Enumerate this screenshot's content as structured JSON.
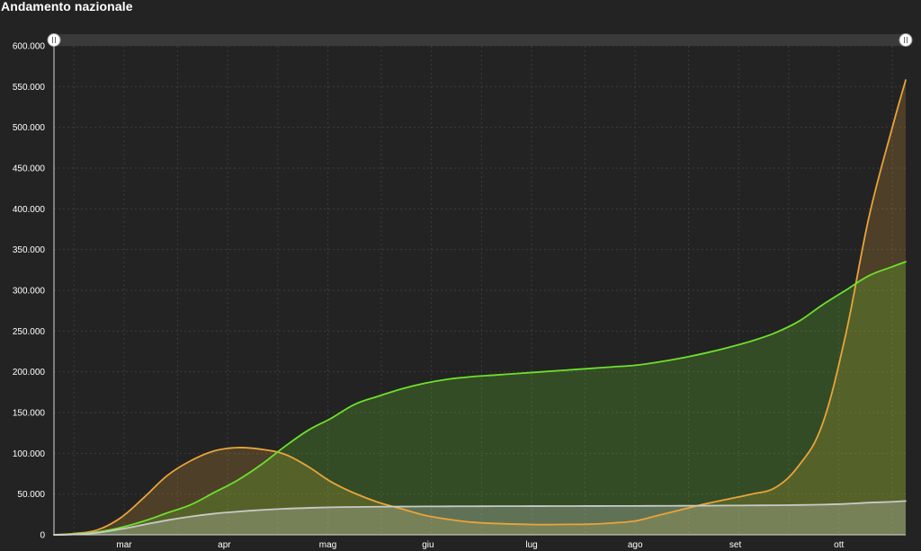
{
  "title": "Andamento nazionale",
  "colors": {
    "background": "#232323",
    "orange": "#e9a43a",
    "green": "#6ee02c",
    "gray": "#c9c9c6",
    "grid": "#3c3c3c",
    "range_bar": "#3a3a3a"
  },
  "chart_data": {
    "type": "area",
    "title": "Andamento nazionale",
    "ylim": [
      0,
      600000
    ],
    "y_ticks": [
      0,
      50000,
      100000,
      150000,
      200000,
      250000,
      300000,
      350000,
      400000,
      450000,
      500000,
      550000,
      600000
    ],
    "y_tick_labels": [
      "0",
      "50.000",
      "100.000",
      "150.000",
      "200.000",
      "250.000",
      "300.000",
      "350.000",
      "400.000",
      "450.000",
      "500.000",
      "550.000",
      "600.000"
    ],
    "x_tick_labels": [
      "mar",
      "apr",
      "mag",
      "giu",
      "lug",
      "ago",
      "set",
      "ott"
    ],
    "x": [
      "2020-02-24",
      "2020-03-01",
      "2020-03-08",
      "2020-03-15",
      "2020-03-22",
      "2020-03-29",
      "2020-04-05",
      "2020-04-12",
      "2020-04-19",
      "2020-04-26",
      "2020-05-03",
      "2020-05-10",
      "2020-05-17",
      "2020-05-24",
      "2020-05-31",
      "2020-06-07",
      "2020-06-14",
      "2020-06-21",
      "2020-06-28",
      "2020-07-05",
      "2020-07-12",
      "2020-07-19",
      "2020-07-26",
      "2020-08-02",
      "2020-08-09",
      "2020-08-16",
      "2020-08-23",
      "2020-08-30",
      "2020-09-06",
      "2020-09-13",
      "2020-09-20",
      "2020-09-27",
      "2020-10-04",
      "2020-10-11",
      "2020-10-18",
      "2020-10-25",
      "2020-11-01",
      "2020-11-05"
    ],
    "grid": true,
    "legend": "none",
    "series": [
      {
        "color": "#e9a43a",
        "values": [
          0,
          1500,
          6000,
          21000,
          46000,
          73000,
          91000,
          103000,
          107000,
          105000,
          99000,
          84000,
          65000,
          51000,
          40000,
          32000,
          24000,
          19000,
          15500,
          14000,
          13000,
          12500,
          12800,
          13000,
          14500,
          17000,
          24000,
          31000,
          38000,
          44000,
          50000,
          58000,
          85000,
          135000,
          245000,
          390000,
          500000,
          558000
        ]
      },
      {
        "color": "#6ee02c",
        "values": [
          0,
          1000,
          3500,
          9000,
          17000,
          27000,
          37000,
          52000,
          67000,
          86000,
          108000,
          128000,
          143000,
          160000,
          170000,
          179000,
          186000,
          191000,
          194000,
          196000,
          198000,
          200000,
          202000,
          204000,
          206000,
          208000,
          212000,
          217000,
          223000,
          230000,
          238000,
          248000,
          262000,
          282000,
          300000,
          318000,
          329000,
          335000
        ]
      },
      {
        "color": "#c9c9c6",
        "values": [
          0,
          500,
          2500,
          7000,
          12500,
          18000,
          22500,
          26000,
          28500,
          30500,
          32000,
          33000,
          33800,
          34200,
          34500,
          34700,
          34850,
          34950,
          35050,
          35150,
          35200,
          35250,
          35300,
          35350,
          35400,
          35450,
          35550,
          35650,
          35800,
          35950,
          36100,
          36300,
          36600,
          37100,
          38000,
          39500,
          40500,
          41500
        ]
      }
    ]
  }
}
